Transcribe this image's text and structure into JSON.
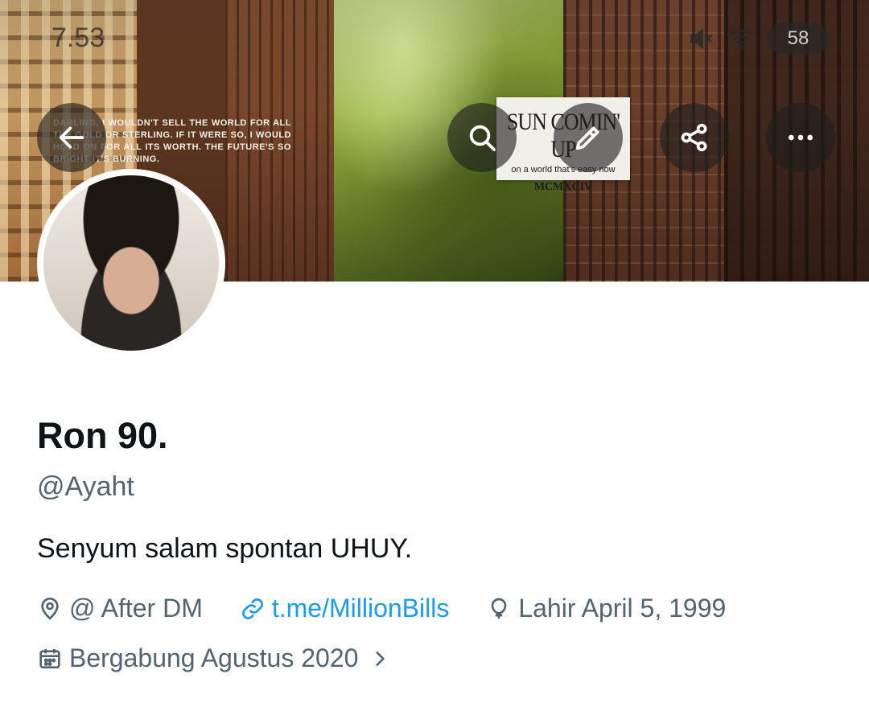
{
  "status_bar": {
    "time": "7.53",
    "battery": "58"
  },
  "header": {
    "quote": "Darling, I wouldn't sell the world for all the gold or sterling. If it were so, I would hold on for all its worth. The future's so bright it's burning.",
    "sticker": {
      "title": "SUN COMIN' UP",
      "subtitle": "on a world that's easy now",
      "year": "MCMXCIV"
    },
    "buttons": [
      "back",
      "search",
      "edit",
      "share",
      "more"
    ]
  },
  "profile": {
    "display_name": "Ron 90.",
    "handle": "@Ayaht",
    "bio": "Senyum salam spontan UHUY.",
    "location": "@ After DM",
    "link": "t.me/MillionBills",
    "birthday": "Lahir April 5, 1999",
    "joined": "Bergabung Agustus 2020"
  },
  "colors": {
    "text_primary": "#0f1419",
    "text_secondary": "#536471",
    "link": "#1d9bf0",
    "button_overlay": "rgba(30,30,30,0.62)"
  },
  "icons": {
    "back": "arrow-left-icon",
    "search": "search-icon",
    "edit": "pencil-icon",
    "share": "share-icon",
    "more": "more-dots-icon",
    "location": "location-pin-icon",
    "link": "link-icon",
    "birthday": "balloon-icon",
    "joined": "calendar-icon"
  }
}
